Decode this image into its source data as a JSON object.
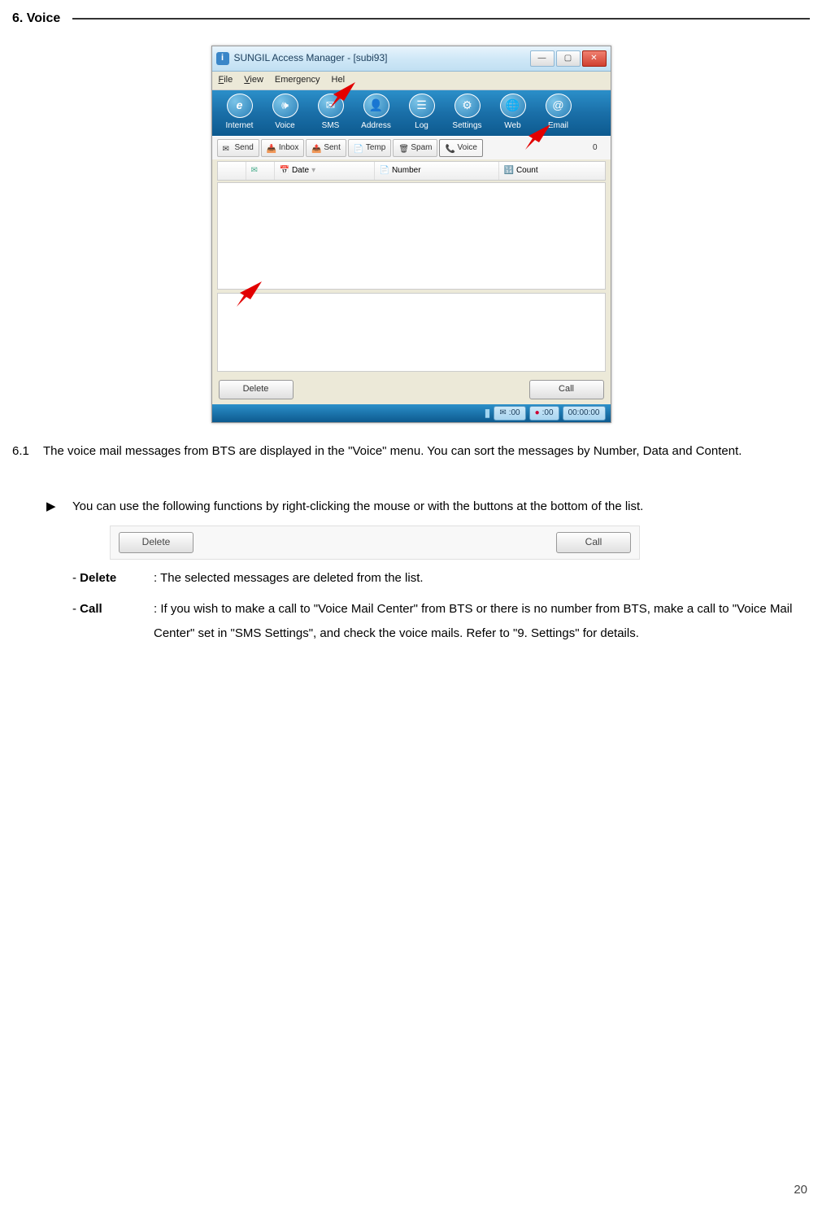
{
  "section_title": "6. Voice",
  "app": {
    "title": "SUNGIL Access Manager - [subi93]",
    "menu": [
      "File",
      "View",
      "Emergency",
      "Help"
    ],
    "toolbar": [
      {
        "label": "Internet",
        "glyph": "e"
      },
      {
        "label": "Voice",
        "glyph": "🔊"
      },
      {
        "label": "SMS",
        "glyph": "✉"
      },
      {
        "label": "Address",
        "glyph": "👤"
      },
      {
        "label": "Log",
        "glyph": "☰"
      },
      {
        "label": "Settings",
        "glyph": "⚙"
      },
      {
        "label": "Web",
        "glyph": "🌐"
      },
      {
        "label": "Email",
        "glyph": "@"
      }
    ],
    "tabs": [
      {
        "label": "Send",
        "icon": "✉"
      },
      {
        "label": "Inbox",
        "icon": "📥"
      },
      {
        "label": "Sent",
        "icon": "📤"
      },
      {
        "label": "Temp",
        "icon": "📄"
      },
      {
        "label": "Spam",
        "icon": "🗑"
      },
      {
        "label": "Voice",
        "icon": "📞"
      }
    ],
    "count": "0",
    "columns": [
      "",
      "",
      "Date",
      "Number",
      "Count"
    ],
    "delete_label": "Delete",
    "call_label": "Call",
    "status": {
      "sms": ":00",
      "voice": ":00",
      "timer": "00:00:00"
    }
  },
  "p61": "The voice mail messages from BTS are displayed in the \"Voice\" menu. You can sort the messages by Number, Data and Content.",
  "p_bullet": "You can use the following functions by right-clicking the mouse or with the buttons at the bottom of the list.",
  "btnbar": {
    "delete": "Delete",
    "call": "Call"
  },
  "defs": {
    "delete_term": "Delete",
    "delete_desc": ": The selected messages are deleted from the list.",
    "call_term": "Call",
    "call_desc": ": If you wish to make a call to \"Voice Mail Center\" from BTS or there is no number from BTS, make a call to \"Voice Mail Center\" set in \"SMS Settings\", and check the voice mails. Refer to \"9. Settings\" for details."
  },
  "page_number": "20",
  "section_num": "6.1"
}
